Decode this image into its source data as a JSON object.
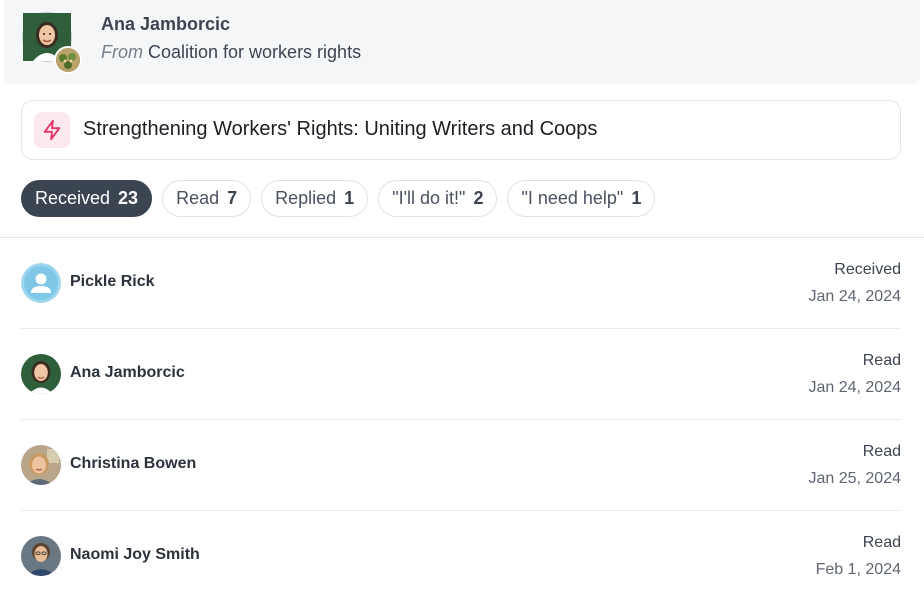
{
  "header": {
    "sender_name": "Ana Jamborcic",
    "from_label": "From",
    "organization": "Coalition for workers rights"
  },
  "campaign": {
    "icon": "lightning-icon",
    "title": "Strengthening Workers' Rights: Uniting Writers and Coops",
    "accent_color": "#e8336a"
  },
  "tabs": [
    {
      "label": "Received",
      "count": "23",
      "active": true
    },
    {
      "label": "Read",
      "count": "7",
      "active": false
    },
    {
      "label": "Replied",
      "count": "1",
      "active": false
    },
    {
      "label": "\"I'll do it!\"",
      "count": "2",
      "active": false
    },
    {
      "label": "\"I need help\"",
      "count": "1",
      "active": false
    }
  ],
  "recipients": [
    {
      "name": "Pickle Rick",
      "status": "Received",
      "date": "Jan 24, 2024",
      "avatar": "default-user-icon"
    },
    {
      "name": "Ana Jamborcic",
      "status": "Read",
      "date": "Jan 24, 2024",
      "avatar": "photo"
    },
    {
      "name": "Christina Bowen",
      "status": "Read",
      "date": "Jan 25, 2024",
      "avatar": "photo"
    },
    {
      "name": "Naomi Joy Smith",
      "status": "Read",
      "date": "Feb 1, 2024",
      "avatar": "photo"
    }
  ]
}
